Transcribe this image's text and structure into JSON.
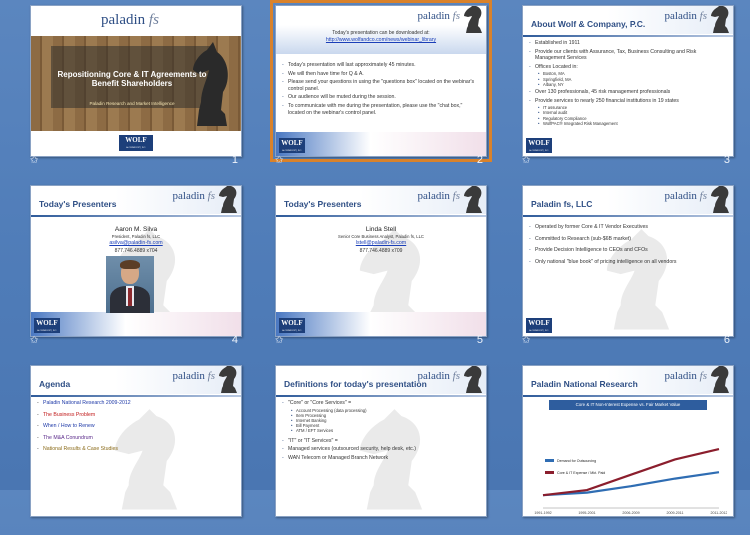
{
  "logo": {
    "brand": "paladin",
    "suffix": "fs",
    "bank": "WOLF",
    "bank_sub": "& COMPANY, P.C."
  },
  "slides": [
    {
      "num": "1",
      "title": "Repositioning Core & IT Agreements to Benefit Shareholders",
      "subtitle": "Paladin Research and Market Intelligence"
    },
    {
      "num": "2",
      "download_line": "Today's presentation  can be downloaded  at:",
      "download_url": "http://www.wolfandco.com/news/webinar_library",
      "bullets": [
        "Today's presentation will last approximately 45 minutes.",
        "We will then have time for Q & A.",
        "Please send your questions in using the \"questions box\" located on the webinar's control panel.",
        "Our audience will be muted during the session.",
        "To communicate with me during the presentation, please use the \"chat box,\" located on the webinar's control panel."
      ]
    },
    {
      "num": "3",
      "title": "About Wolf & Company, P.C.",
      "bullets": [
        {
          "text": "Established in 1911",
          "sub": []
        },
        {
          "text": "Provide our clients with Assurance, Tax, Business Consulting and Risk Management Services",
          "sub": []
        },
        {
          "text": "Offices Located in:",
          "sub": [
            "Boston, MA",
            "Springfield, MA",
            "Albany, NY"
          ]
        },
        {
          "text": "Over 130 professionals, 45 risk management professionals",
          "sub": []
        },
        {
          "text": "Provide services to nearly 250 financial institutions in 19 states",
          "sub": [
            "IT assurance",
            "Internal audit",
            "Regulatory Compliance",
            "WolfPAC® Integrated Risk Management"
          ]
        }
      ]
    },
    {
      "num": "4",
      "title": "Today's Presenters",
      "name": "Aaron M. Silva",
      "role": "President, Paladin  fs, LLC",
      "email": "asilva@paladin-fs.com",
      "phone": "877.746.4889 x704"
    },
    {
      "num": "5",
      "title": "Today's Presenters",
      "name": "Linda Stell",
      "role": "Senior Core Business Analyst, Paladin  fs, LLC",
      "email": "lstell@paladin-fs.com",
      "phone": "877.746.4889 x709"
    },
    {
      "num": "6",
      "title": "Paladin fs, LLC",
      "bullets": [
        "Operated by former Core & IT Vendor Executives",
        "Committed to Research (sub-$6B market)",
        "Provide Decision Intelligence to CEOs and CFOs",
        "Only national \"blue book\" of pricing intelligence on all vendors"
      ]
    },
    {
      "num": "7",
      "title": "Agenda",
      "items": [
        "Paladin National Research 2009-2012",
        "The Business Problem",
        "When / How to Renew",
        "The M&A Conundrum",
        "National Results & Case Studies"
      ]
    },
    {
      "num": "8",
      "title": "Definitions for today's presentation",
      "core_head": "\"Core\" or \"Core Services\" =",
      "core_items": [
        "Account Processing (data processing)",
        "Item Processing",
        "Internet Banking",
        "Bill Payment",
        "ATM / EFT Services"
      ],
      "it_head": "\"IT\" or \"IT Services\" =",
      "it_items": [
        "Managed services (outsourced security, help desk, etc.)",
        "WAN Telecom or Managed Branch Network"
      ]
    },
    {
      "num": "9",
      "title": "Paladin National Research"
    }
  ],
  "chart_data": {
    "type": "line",
    "title": "Core & IT Non-Interest Expense vs. Fair Market Value",
    "categories": [
      "1991-1992",
      "1995-2001",
      "2006-2009",
      "2009-2011",
      "2011-2012"
    ],
    "series": [
      {
        "name": "Demand for Outsourcing",
        "color": "#2f6db3",
        "values": [
          1.0,
          1.2,
          1.7,
          2.3,
          2.8
        ]
      },
      {
        "name": "Core & IT Expense / Mkt. Paid",
        "color": "#8b1e2d",
        "values": [
          1.0,
          1.4,
          2.6,
          3.8,
          4.6
        ]
      }
    ],
    "ylim": [
      0,
      5
    ]
  },
  "colors": {
    "accent": "#2f4f85",
    "selection": "#d9822b",
    "background": "#5b86bf"
  }
}
